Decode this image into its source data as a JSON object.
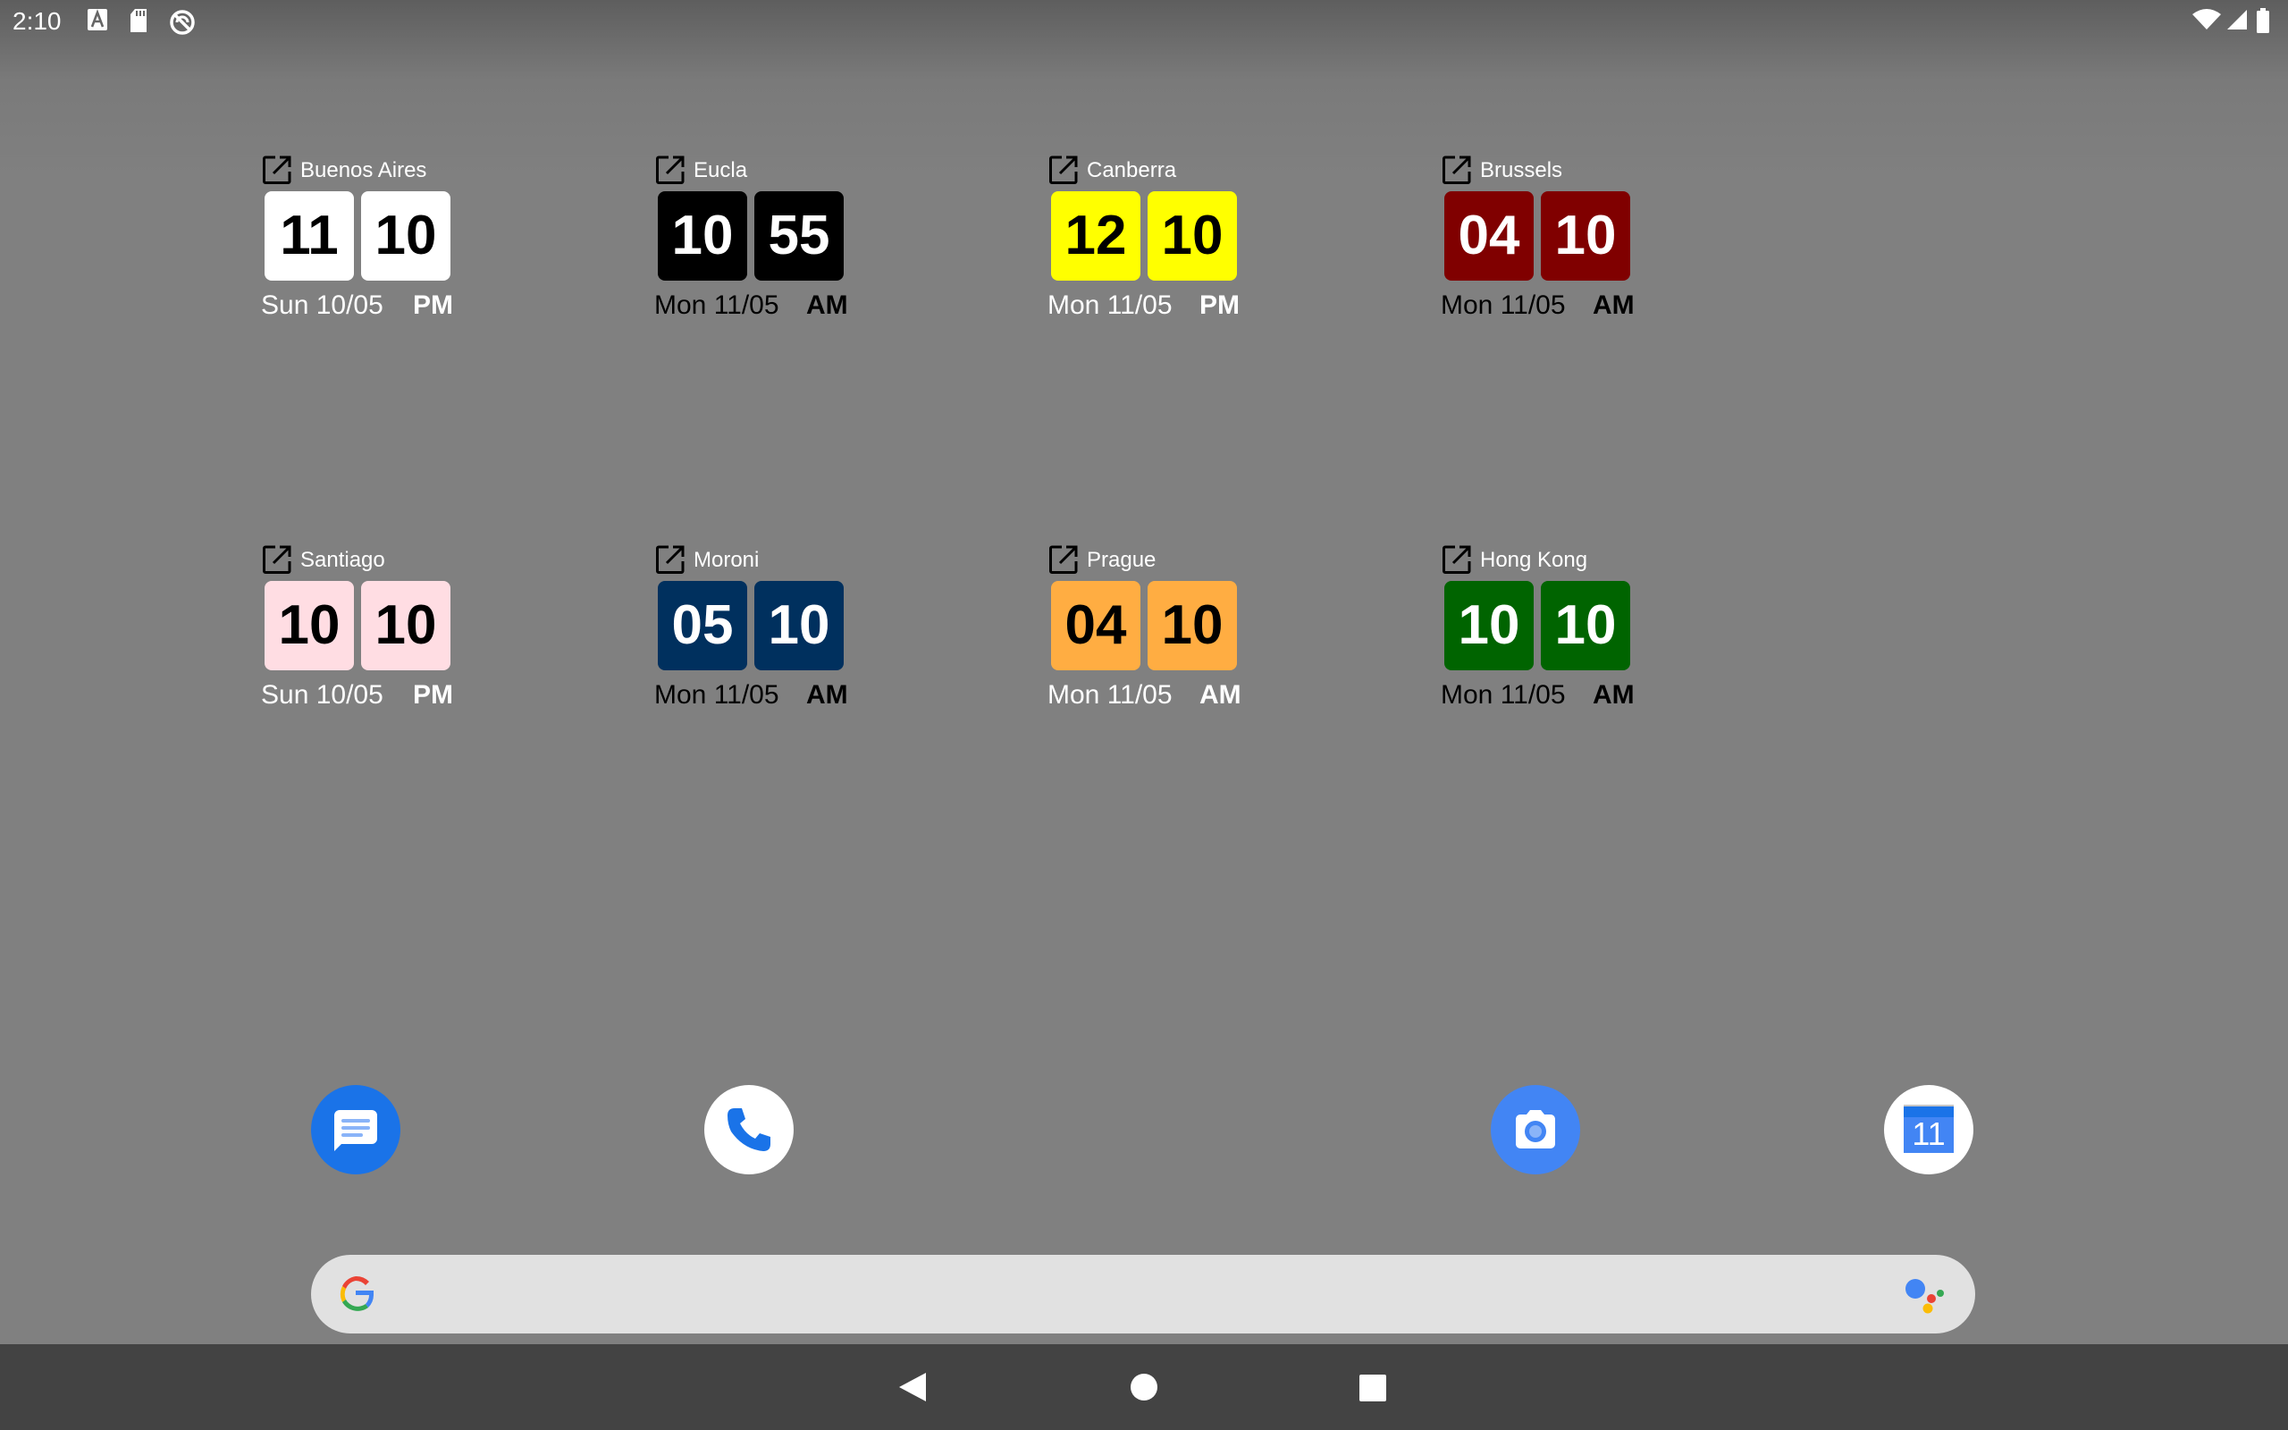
{
  "status_bar": {
    "time": "2:10",
    "left_icons": [
      "font-a-icon",
      "sd-card-icon",
      "sync-icon"
    ],
    "right_icons": [
      "wifi-icon",
      "cell-signal-icon",
      "battery-icon"
    ]
  },
  "widgets": [
    {
      "city": "Buenos Aires",
      "hour": "11",
      "minute": "10",
      "date": "Sun 10/05",
      "ampm": "PM",
      "tile_bg": "#ffffff",
      "tile_fg": "#000000",
      "text_color": "#ffffff"
    },
    {
      "city": "Eucla",
      "hour": "10",
      "minute": "55",
      "date": "Mon 11/05",
      "ampm": "AM",
      "tile_bg": "#000000",
      "tile_fg": "#ffffff",
      "text_color": "#000000"
    },
    {
      "city": "Canberra",
      "hour": "12",
      "minute": "10",
      "date": "Mon 11/05",
      "ampm": "PM",
      "tile_bg": "#ffff00",
      "tile_fg": "#000000",
      "text_color": "#ffffff"
    },
    {
      "city": "Brussels",
      "hour": "04",
      "minute": "10",
      "date": "Mon 11/05",
      "ampm": "AM",
      "tile_bg": "#800000",
      "tile_fg": "#ffffff",
      "text_color": "#000000"
    },
    {
      "city": "Santiago",
      "hour": "10",
      "minute": "10",
      "date": "Sun 10/05",
      "ampm": "PM",
      "tile_bg": "#ffdde3",
      "tile_fg": "#000000",
      "text_color": "#ffffff"
    },
    {
      "city": "Moroni",
      "hour": "05",
      "minute": "10",
      "date": "Mon 11/05",
      "ampm": "AM",
      "tile_bg": "#00305e",
      "tile_fg": "#ffffff",
      "text_color": "#000000"
    },
    {
      "city": "Prague",
      "hour": "04",
      "minute": "10",
      "date": "Mon 11/05",
      "ampm": "AM",
      "tile_bg": "#ffad42",
      "tile_fg": "#000000",
      "text_color": "#ffffff"
    },
    {
      "city": "Hong Kong",
      "hour": "10",
      "minute": "10",
      "date": "Mon 11/05",
      "ampm": "AM",
      "tile_bg": "#006400",
      "tile_fg": "#ffffff",
      "text_color": "#000000"
    }
  ],
  "dock": {
    "apps": [
      {
        "icon": "messages-icon",
        "bg": "#1a73e8"
      },
      {
        "icon": "phone-icon",
        "bg": "#ffffff"
      },
      {
        "icon": "camera-icon",
        "bg": "#4285f4"
      },
      {
        "icon": "calendar-icon",
        "bg": "#ffffff",
        "label": "11"
      }
    ]
  },
  "search": {
    "icon": "google-g-icon",
    "assistant_icon": "assistant-icon",
    "bg": "#e1e1e1"
  },
  "navigation": {
    "buttons": [
      "back-icon",
      "home-icon",
      "recents-icon"
    ],
    "bg": "#434343"
  }
}
